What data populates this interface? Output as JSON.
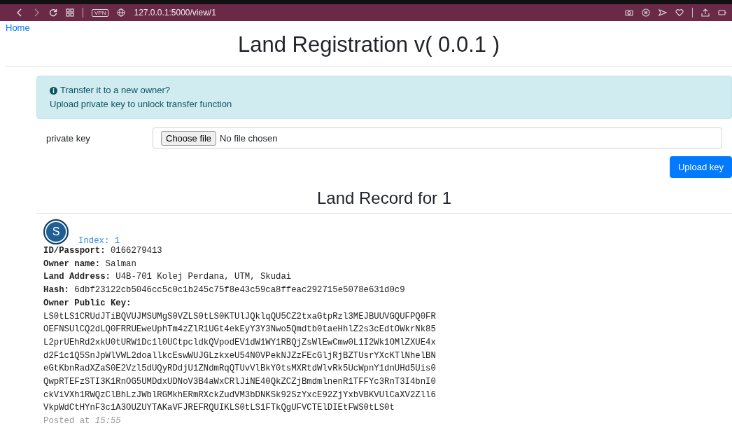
{
  "browser": {
    "vpn_label": "VPN",
    "url": "127.0.0.1:5000/view/1"
  },
  "nav": {
    "home_link": "Home"
  },
  "page_title": "Land Registration v( 0.0.1 )",
  "alert": {
    "lines": [
      "Transfer it to a new owner?",
      "Upload private key to unlock transfer function"
    ]
  },
  "form": {
    "label": "private key",
    "file_button": "Choose file",
    "file_status": "No file chosen",
    "submit_button": "Upload key"
  },
  "record_title": "Land Record for 1",
  "record": {
    "avatar_letter": "S",
    "index": "Index: 1",
    "fields": [
      {
        "label": "ID/Passport:",
        "value": "0166279413"
      },
      {
        "label": "Owner name:",
        "value": "Salman"
      },
      {
        "label": "Land Address:",
        "value": "U4B-701 Kolej Perdana, UTM, Skudai"
      },
      {
        "label": "Hash:",
        "value": "6dbf23122cb5046cc5c0c1b245c75f8e43c59ca8ffeac292715e5078e631d0c9"
      }
    ],
    "public_key_label": "Owner Public Key:",
    "public_key_lines": [
      "LS0tLS1CRUdJTiBQVUJMSUMgS0VZLS0tLS0KTUlJQklqQU5CZ2txaGtpRzl3MEJBUUVGQUFPQ0FR",
      "OEFNSUlCQ2dLQ0FRRUEweUphTm4zZlR1UGt4ekEyY3Y3Nwo5Qmdtb0taeHhlZ2s3cEdtOWkrNk85",
      "L2prUEhRd2xkU0tURW1Dc1l0UCtpcldkQVpodEV1dW1WY1RBQjZsWlEwCmw0L1I2Wk1OMlZXUE4x",
      "d2F1c1Q5SnJpWlVWL2doallkcEswWUJGLzkxeU54N0VPekNJZzFEcGljRjBZTUsrYXcKTlNhelBN",
      "eGtKbnRadXZaS0E2Vzl5dUQyRDdjU1ZNdmRqQTUvVlBkY0tsMXRtdWlvRk5UcWpnY1dnUHd5Uis0",
      "QwpRTEFzSTI3K1RnOG5UMDdxUDNoV3B4aWxCRlJiNE40QkZCZjBmdmlnenR1TFFYc3RnT3I4bnI0",
      "ckViVXh1RWQzClBhLzJWblRGMkhERmRXckZudVM3bDNKSk92SzYxcE92ZjYxbVBKVUlCaXV2Zll6",
      "VkpWdCtHYnF3c1A3OUZUYTAKaVFJREFRQUIKLS0tLS1FTkQgUFVCTElDIEtFWS0tLS0t"
    ],
    "posted_label": "Posted at",
    "posted_time": "15:55"
  }
}
